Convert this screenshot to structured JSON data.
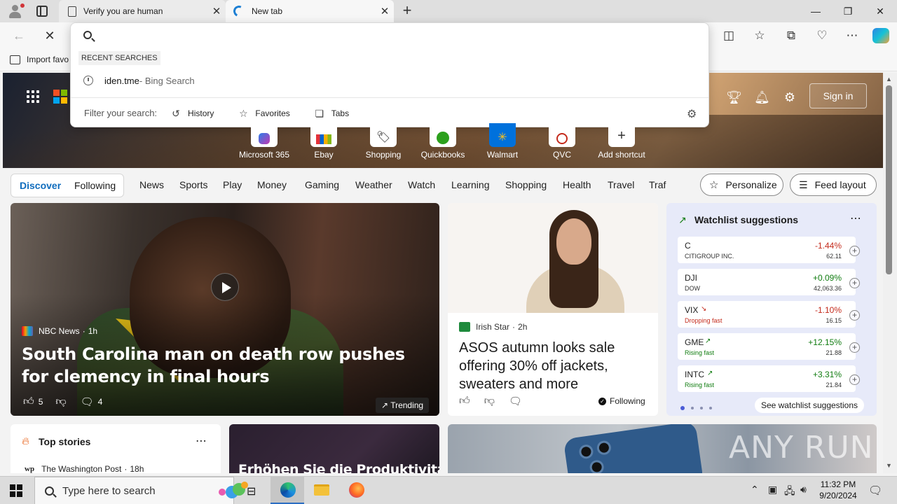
{
  "tabs": [
    {
      "title": "Verify you are human",
      "icon": "document-icon"
    },
    {
      "title": "New tab",
      "icon": "edge-loading-icon"
    }
  ],
  "favorites": {
    "import_label": "Import favo"
  },
  "omnibox": {
    "query": "",
    "recent_label": "RECENT SEARCHES",
    "recent": [
      {
        "text": "iden.tme",
        "suffix": " - Bing Search"
      }
    ],
    "filter_label": "Filter your search:",
    "filters": [
      "History",
      "Favorites",
      "Tabs"
    ]
  },
  "hero": {
    "signin_label": "Sign in",
    "shortcuts": [
      {
        "label": "Microsoft 365"
      },
      {
        "label": "Ebay"
      },
      {
        "label": "Shopping"
      },
      {
        "label": "Quickbooks"
      },
      {
        "label": "Walmart"
      },
      {
        "label": "QVC"
      },
      {
        "label": "Add shortcut"
      }
    ]
  },
  "nav": {
    "tabs": [
      "Discover",
      "Following"
    ],
    "links": [
      "News",
      "Sports",
      "Play",
      "Money",
      "Gaming",
      "Weather",
      "Watch",
      "Learning",
      "Shopping",
      "Health",
      "Travel",
      "Traf"
    ],
    "personalize": "Personalize",
    "feed_layout": "Feed layout"
  },
  "main_story": {
    "source": "NBC News",
    "age": "1h",
    "title": "South Carolina man on death row pushes for clemency in final hours",
    "likes": "5",
    "comments": "4",
    "trending_label": "Trending"
  },
  "second_story": {
    "source": "Irish Star",
    "age": "2h",
    "title": "ASOS autumn looks sale offering 30% off jackets, sweaters and more",
    "following_label": "Following"
  },
  "watchlist": {
    "title": "Watchlist suggestions",
    "items": [
      {
        "symbol": "C",
        "sub": "CITIGROUP INC.",
        "change": "-1.44%",
        "price": "62.11",
        "dir": "down"
      },
      {
        "symbol": "DJI",
        "sub": "DOW",
        "change": "+0.09%",
        "price": "42,063.36",
        "dir": "up"
      },
      {
        "symbol": "VIX",
        "sub": "Dropping fast",
        "change": "-1.10%",
        "price": "16.15",
        "dir": "down"
      },
      {
        "symbol": "GME",
        "sub": "Rising fast",
        "change": "+12.15%",
        "price": "21.88",
        "dir": "up"
      },
      {
        "symbol": "INTC",
        "sub": "Rising fast",
        "change": "+3.31%",
        "price": "21.84",
        "dir": "up"
      }
    ],
    "see_more": "See watchlist suggestions"
  },
  "top_stories": {
    "title": "Top stories",
    "source": "The Washington Post",
    "age": "18h"
  },
  "promo": {
    "text": "Erhöhen Sie die Produktivität"
  },
  "watermark": "ANY RUN",
  "taskbar": {
    "search_placeholder": "Type here to search",
    "time": "11:32 PM",
    "date": "9/20/2024"
  },
  "colors": {
    "accent": "#0f6cbd",
    "negative": "#c42b1c",
    "positive": "#107c10"
  }
}
